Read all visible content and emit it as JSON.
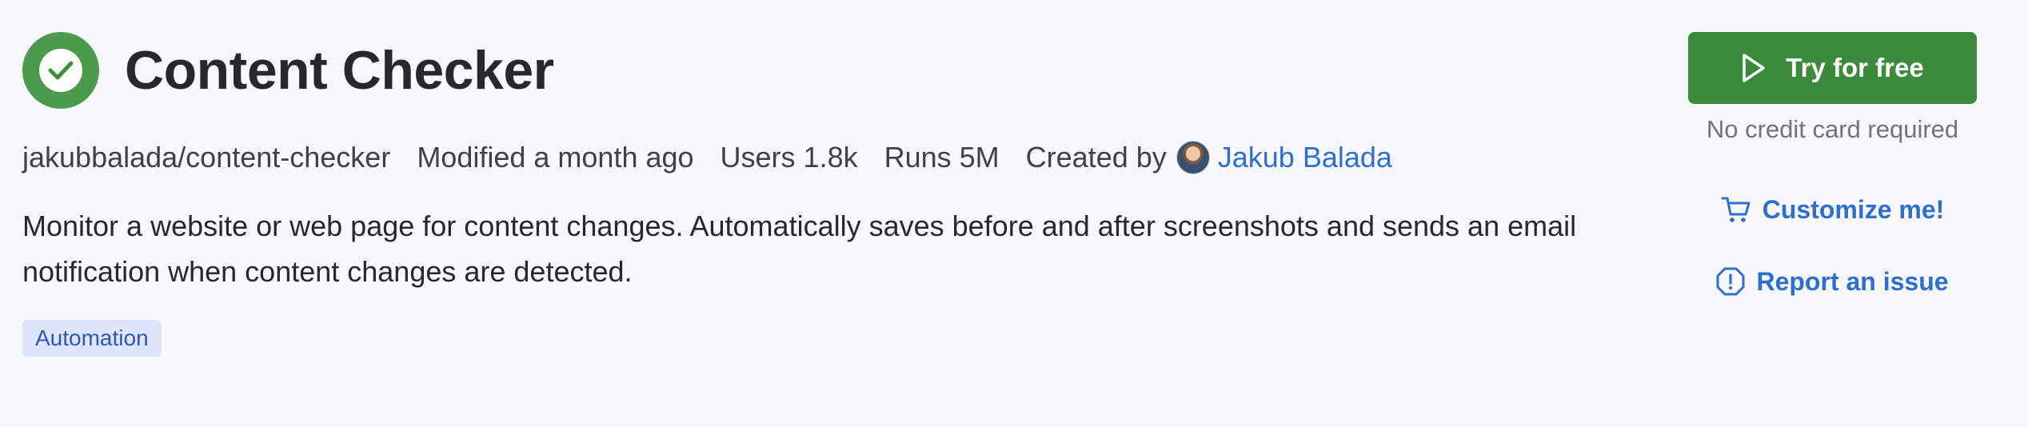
{
  "header": {
    "logo_icon": "check-circle-icon",
    "title": "Content Checker"
  },
  "meta": {
    "slug": "jakubbalada/content-checker",
    "modified": "Modified a month ago",
    "users": "Users 1.8k",
    "runs": "Runs 5M",
    "created_by_label": "Created by",
    "author_name": "Jakub Balada",
    "author_avatar_icon": "user-avatar"
  },
  "description": "Monitor a website or web page for content changes. Automatically saves before and after screenshots and sends an email notification when content changes are detected.",
  "tags": [
    "Automation"
  ],
  "actions": {
    "try_label": "Try for free",
    "try_icon": "play-icon",
    "no_card_label": "No credit card required",
    "customize_label": "Customize me!",
    "customize_icon": "cart-icon",
    "report_label": "Report an issue",
    "report_icon": "alert-octagon-icon"
  },
  "colors": {
    "background": "#f8f8fc",
    "brand_green": "#3b8a3b",
    "logo_green": "#4c9a4c",
    "link_blue": "#2d6fcf",
    "tag_bg": "#dfe6fb",
    "tag_text": "#2f56b6"
  }
}
